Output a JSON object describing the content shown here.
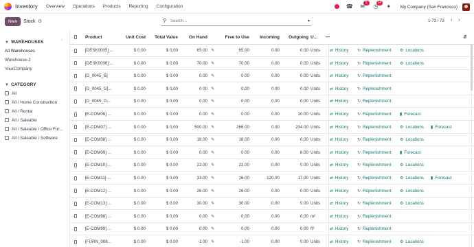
{
  "app": {
    "name": "Inventory",
    "menu": [
      "Overview",
      "Operations",
      "Products",
      "Reporting",
      "Configuration"
    ],
    "company": "My Company (San Francisco)",
    "badges": {
      "activity": "14",
      "messages": "5"
    }
  },
  "control": {
    "new_label": "New",
    "title": "Stock",
    "search_placeholder": "Search...",
    "pager": "1-73 / 73"
  },
  "sidebar": {
    "warehouses_title": "WAREHOUSES",
    "warehouses": [
      "All Warehouses",
      "Warehouse-2",
      "YourCompany"
    ],
    "category_title": "CATEGORY",
    "categories": [
      "All",
      "All / Home Construction",
      "All / Rental",
      "All / Saleable",
      "All / Saleable / Office Fur...",
      "All / Saleable / Software"
    ]
  },
  "table": {
    "columns": [
      "Product",
      "Unit Cost",
      "Total Value",
      "On Hand",
      "Free to Use",
      "Incoming",
      "Outgoing",
      "U..."
    ],
    "rows": [
      {
        "product": "[DESK0005] ...",
        "cost": "$ 0.00",
        "value": "$ 0.00",
        "onhand": "65.00",
        "free": "65.00",
        "incoming": "0.00",
        "outgoing": "0.00",
        "unit": "Units",
        "actions": [
          "History",
          "Replenishment",
          "Locations"
        ]
      },
      {
        "product": "[DESK0006] ...",
        "cost": "$ 0.00",
        "value": "$ 0.00",
        "onhand": "70.00",
        "free": "70.00",
        "incoming": "0.00",
        "outgoing": "0.00",
        "unit": "Units",
        "actions": [
          "History",
          "Replenishment",
          "Locations"
        ]
      },
      {
        "product": "[D_0045_B]",
        "cost": "$ 0.00",
        "value": "$ 0.00",
        "onhand": "0.00",
        "free": "0.00",
        "incoming": "0.00",
        "outgoing": "0.00",
        "unit": "Units",
        "actions": [
          "History",
          "Replenishment"
        ]
      },
      {
        "product": "[D_0045_G]...",
        "cost": "$ 0.00",
        "value": "$ 0.00",
        "onhand": "0.00",
        "free": "0.00",
        "incoming": "0.00",
        "outgoing": "0.00",
        "unit": "Units",
        "actions": [
          "History",
          "Replenishment"
        ]
      },
      {
        "product": "[D_0045_G...",
        "cost": "$ 0.00",
        "value": "$ 0.00",
        "onhand": "0.00",
        "free": "0.00",
        "incoming": "0.00",
        "outgoing": "0.00",
        "unit": "Units",
        "actions": [
          "History",
          "Replenishment"
        ]
      },
      {
        "product": "[E-COM06] ...",
        "cost": "$ 0.00",
        "value": "$ 0.00",
        "onhand": "0.00",
        "free": "0.00",
        "incoming": "0.00",
        "outgoing": "10.00",
        "unit": "Units",
        "actions": [
          "History",
          "Replenishment",
          "Forecast"
        ]
      },
      {
        "product": "[E-COM07] ...",
        "cost": "$ 0.00",
        "value": "$ 0.00",
        "onhand": "500.00",
        "free": "266.00",
        "incoming": "0.00",
        "outgoing": "234.00",
        "unit": "Units",
        "actions": [
          "History",
          "Replenishment",
          "Locations",
          "Forecast"
        ]
      },
      {
        "product": "[E-COM08] ...",
        "cost": "$ 0.00",
        "value": "$ 0.00",
        "onhand": "18.00",
        "free": "18.00",
        "incoming": "0.00",
        "outgoing": "0.00",
        "unit": "Units",
        "actions": [
          "History",
          "Replenishment",
          "Locations"
        ]
      },
      {
        "product": "[E-COM09] ...",
        "cost": "$ 0.00",
        "value": "$ 0.00",
        "onhand": "0.00",
        "free": "0.00",
        "incoming": "0.00",
        "outgoing": "6.00",
        "unit": "Units",
        "actions": [
          "History",
          "Replenishment",
          "Forecast"
        ]
      },
      {
        "product": "[E-COM10] ...",
        "cost": "$ 0.00",
        "value": "$ 0.00",
        "onhand": "22.00",
        "free": "22.00",
        "incoming": "0.00",
        "outgoing": "0.00",
        "unit": "Units",
        "actions": [
          "History",
          "Replenishment",
          "Locations"
        ]
      },
      {
        "product": "[E-COM11] ...",
        "cost": "$ 0.00",
        "value": "$ 0.00",
        "onhand": "33.00",
        "free": "16.00",
        "incoming": "120.00",
        "outgoing": "17.00",
        "unit": "Units",
        "actions": [
          "History",
          "Replenishment",
          "Locations",
          "Forecast"
        ]
      },
      {
        "product": "[E-COM12] ...",
        "cost": "$ 0.00",
        "value": "$ 0.00",
        "onhand": "26.00",
        "free": "26.00",
        "incoming": "0.00",
        "outgoing": "0.00",
        "unit": "Units",
        "actions": [
          "History",
          "Replenishment",
          "Locations"
        ]
      },
      {
        "product": "[E-COM13] ...",
        "cost": "$ 0.00",
        "value": "$ 0.00",
        "onhand": "30.00",
        "free": "30.00",
        "incoming": "0.00",
        "outgoing": "0.00",
        "unit": "Units",
        "actions": [
          "History",
          "Replenishment",
          "Locations"
        ]
      },
      {
        "product": "[E-COM98] ...",
        "cost": "$ 0.00",
        "value": "$ 0.00",
        "onhand": "0.00",
        "free": "0.00",
        "incoming": "0.00",
        "outgoing": "0.00",
        "unit": "m²",
        "actions": [
          "History",
          "Replenishment"
        ]
      },
      {
        "product": "[E-COM99] ...",
        "cost": "$ 0.00",
        "value": "$ 0.00",
        "onhand": "0.00",
        "free": "0.00",
        "incoming": "0.00",
        "outgoing": "0.00",
        "unit": "ft²",
        "actions": [
          "History",
          "Replenishment"
        ]
      },
      {
        "product": "[FURN_008...",
        "cost": "$ 0.00",
        "value": "$ 0.00",
        "onhand": "-1.00",
        "free": "-1.00",
        "incoming": "0.00",
        "outgoing": "0.00",
        "unit": "Units",
        "actions": [
          "History",
          "Replenishment",
          "Locations"
        ]
      }
    ]
  },
  "colors": {
    "brand": "#714b67",
    "action": "#0f766e",
    "badge": "#e11d48"
  }
}
